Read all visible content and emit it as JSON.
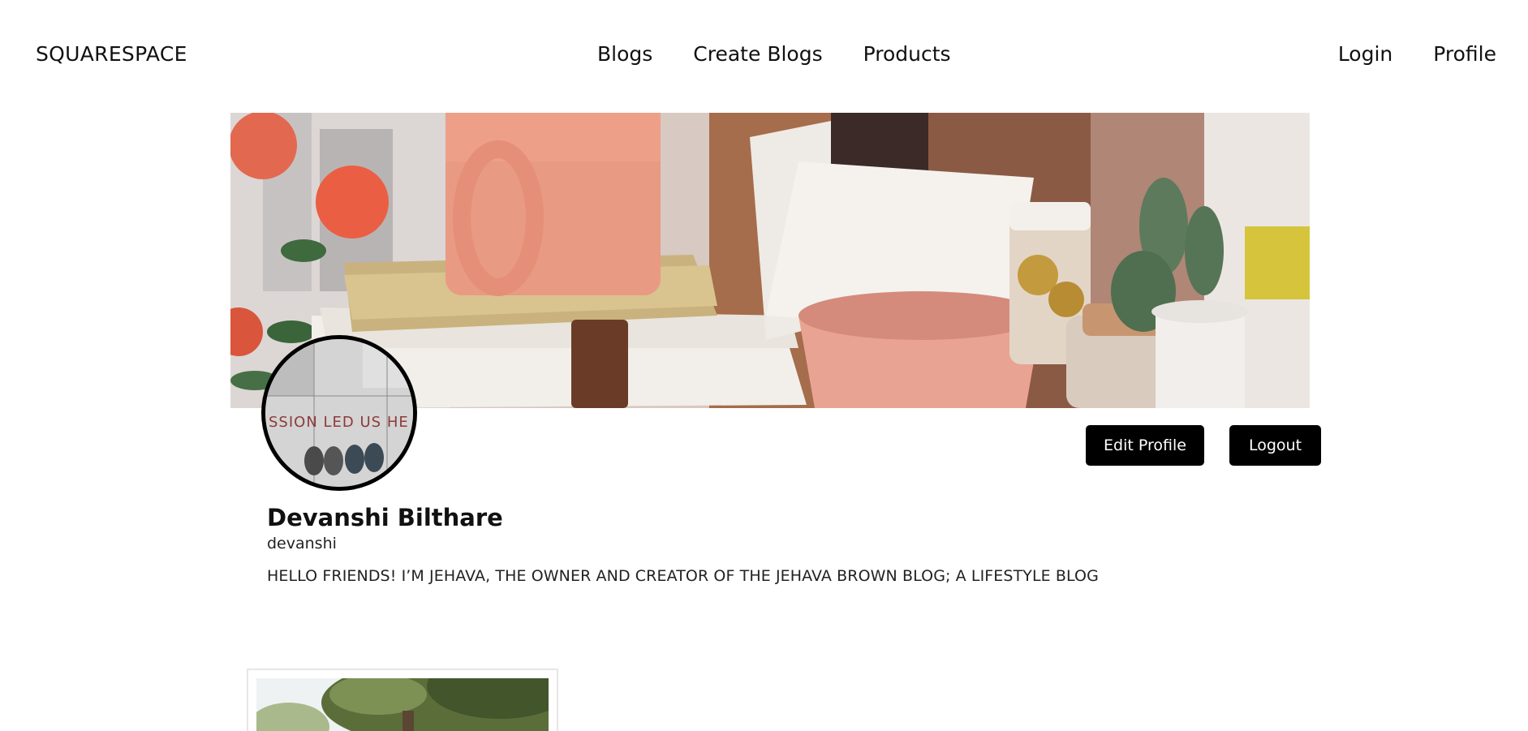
{
  "nav": {
    "brand": "SQUARESPACE",
    "center_links": [
      "Blogs",
      "Create Blogs",
      "Products"
    ],
    "right_links": [
      "Login",
      "Profile"
    ]
  },
  "banner": {
    "image": "desk-scene-banner",
    "subject": "pink mug, notebooks, roses, cactus, jars"
  },
  "avatar": {
    "image": "avatar-photo",
    "text_on_image": "SSION LED US HE"
  },
  "actions": {
    "edit_label": "Edit Profile",
    "logout_label": "Logout"
  },
  "profile": {
    "name": "Devanshi Bilthare",
    "username": "devanshi",
    "bio": "HELLO FRIENDS! I’M JEHAVA, THE OWNER AND CREATOR OF THE JEHAVA BROWN BLOG; A LIFESTYLE BLOG"
  },
  "blog_card": {
    "image": "tree-thumbnail"
  },
  "colors": {
    "background": "#ffffff",
    "button_bg": "#000000",
    "button_text": "#ffffff",
    "text": "#111111"
  }
}
